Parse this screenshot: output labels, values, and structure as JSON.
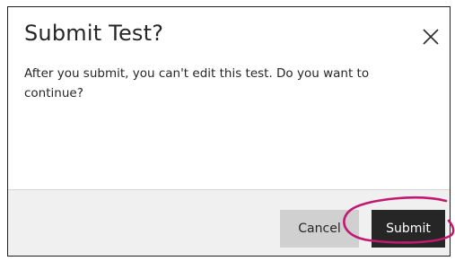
{
  "dialog": {
    "title": "Submit Test?",
    "close_icon": "close-icon",
    "message": "After you submit, you can't edit this test. Do you want to continue?",
    "cancel_label": "Cancel",
    "submit_label": "Submit"
  },
  "colors": {
    "submit_bg": "#262626",
    "cancel_bg": "#d0d0d0",
    "footer_bg": "#f0f0f0",
    "highlight_ring": "#c3186f"
  }
}
